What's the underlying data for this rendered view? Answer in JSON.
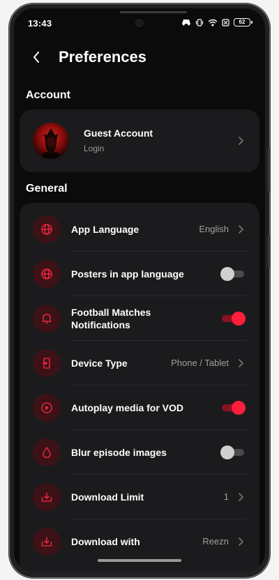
{
  "status_bar": {
    "time": "13:43",
    "battery": "62"
  },
  "header": {
    "title": "Preferences"
  },
  "account_section": {
    "title": "Account",
    "name": "Guest Account",
    "subtitle": "Login"
  },
  "general_section": {
    "title": "General",
    "items": [
      {
        "label": "App Language",
        "value": "English",
        "icon": "globe-icon"
      },
      {
        "label": "Posters in app language",
        "toggle": false,
        "icon": "globe-icon"
      },
      {
        "label": "Football Matches Notifications",
        "toggle": true,
        "icon": "bell-icon"
      },
      {
        "label": "Device Type",
        "value": "Phone / Tablet",
        "icon": "device-icon"
      },
      {
        "label": "Autoplay media for VOD",
        "toggle": true,
        "icon": "play-icon"
      },
      {
        "label": "Blur episode images",
        "toggle": false,
        "icon": "drop-icon"
      },
      {
        "label": "Download Limit",
        "value": "1",
        "icon": "download-icon"
      },
      {
        "label": "Download with",
        "value": "Reezn",
        "icon": "download-icon"
      }
    ]
  },
  "colors": {
    "accent": "#ff1f3a",
    "background": "#0b0b0b",
    "card": "#1b1b1d"
  }
}
